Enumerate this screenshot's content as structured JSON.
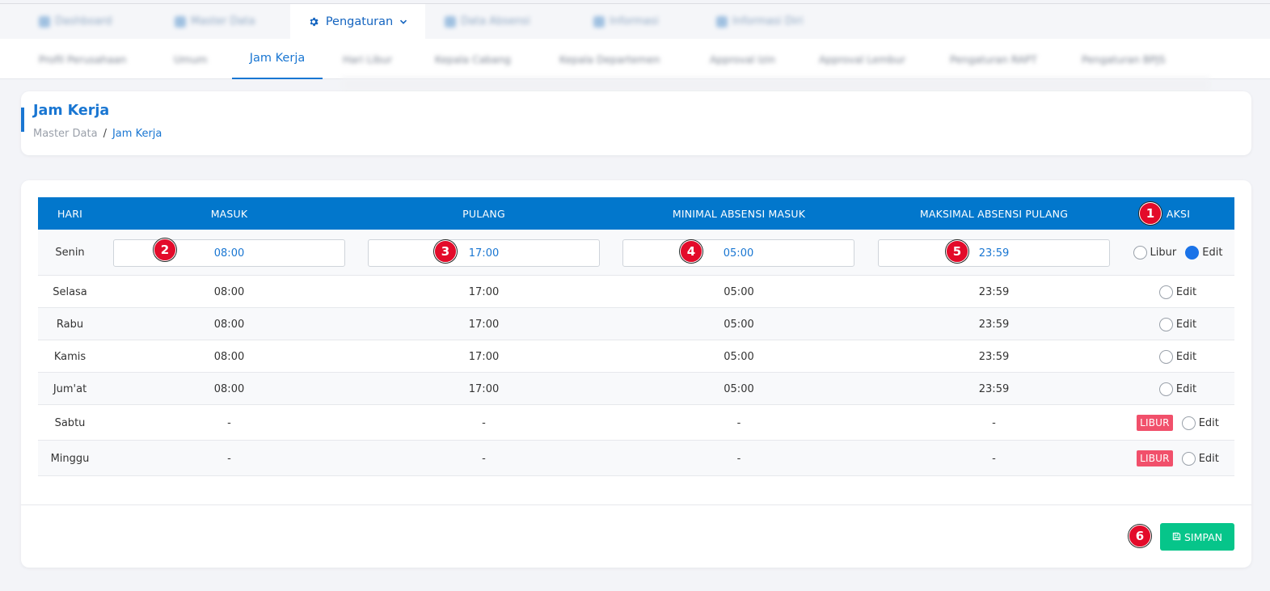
{
  "topnav": {
    "blurred_items": [
      "Dashboard",
      "Master Data",
      "Data Absensi",
      "Informasi",
      "Informasi Diri"
    ],
    "active_label": "Pengaturan"
  },
  "subnav": {
    "blurred_items": [
      "Profil Perusahaan",
      "Umum",
      "Hari Libur",
      "Kepala Cabang",
      "Kepala Departemen",
      "Approval Izin",
      "Approval Lembur",
      "Pengaturan RAPT",
      "Pengaturan BPJS"
    ],
    "active_label": "Jam Kerja"
  },
  "header": {
    "title": "Jam Kerja",
    "breadcrumb_root": "Master Data",
    "breadcrumb_sep": "/",
    "breadcrumb_current": "Jam Kerja"
  },
  "table": {
    "columns": [
      "HARI",
      "MASUK",
      "PULANG",
      "MINIMAL ABSENSI MASUK",
      "MAKSIMAL ABSENSI PULANG",
      "AKSI"
    ],
    "edit_row": {
      "day": "Senin",
      "masuk": "08:00",
      "pulang": "17:00",
      "minimal_masuk": "05:00",
      "maksimal_pulang": "23:59",
      "libur_label": "Libur",
      "edit_label": "Edit"
    },
    "rows": [
      {
        "day": "Selasa",
        "masuk": "08:00",
        "pulang": "17:00",
        "min": "05:00",
        "max": "23:59",
        "edit": "Edit"
      },
      {
        "day": "Rabu",
        "masuk": "08:00",
        "pulang": "17:00",
        "min": "05:00",
        "max": "23:59",
        "edit": "Edit"
      },
      {
        "day": "Kamis",
        "masuk": "08:00",
        "pulang": "17:00",
        "min": "05:00",
        "max": "23:59",
        "edit": "Edit"
      },
      {
        "day": "Jum'at",
        "masuk": "08:00",
        "pulang": "17:00",
        "min": "05:00",
        "max": "23:59",
        "edit": "Edit"
      },
      {
        "day": "Sabtu",
        "masuk": "-",
        "pulang": "-",
        "min": "-",
        "max": "-",
        "badge": "LIBUR",
        "edit": "Edit"
      },
      {
        "day": "Minggu",
        "masuk": "-",
        "pulang": "-",
        "min": "-",
        "max": "-",
        "badge": "LIBUR",
        "edit": "Edit"
      }
    ]
  },
  "markers": [
    "1",
    "2",
    "3",
    "4",
    "5",
    "6"
  ],
  "footer": {
    "save_label": "SIMPAN"
  },
  "colors": {
    "accent": "#1976d2",
    "table_header": "#0277cc",
    "save_button": "#06c58a",
    "libur_badge": "#f1506b",
    "marker": "#e30b2a"
  }
}
